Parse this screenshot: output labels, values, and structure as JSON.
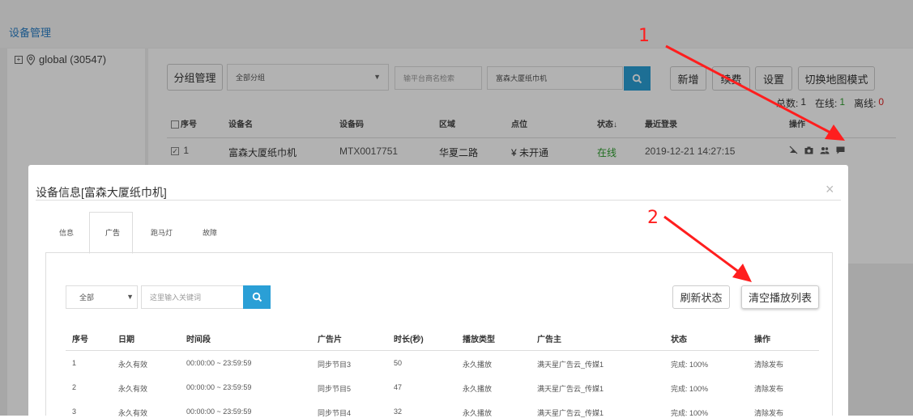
{
  "breadcrumb": "设备管理",
  "tree": {
    "node_label": "global (30547)"
  },
  "toolbar": {
    "group_manage": "分组管理",
    "group_select": "全部分组",
    "platform_search_placeholder": "输平台商名检索",
    "keyword_value": "富森大厦纸巾机",
    "add": "新增",
    "renew": "续费",
    "settings": "设置",
    "map_mode": "切换地图模式"
  },
  "stats": {
    "total_label": "总数:",
    "total": "1",
    "online_label": "在线:",
    "online": "1",
    "offline_label": "离线:",
    "offline": "0"
  },
  "device_table": {
    "headers": [
      "序号",
      "设备名",
      "设备码",
      "区域",
      "点位",
      "状态↓",
      "最近登录",
      "操作"
    ],
    "row": {
      "index": "1",
      "name": "富森大厦纸巾机",
      "code": "MTX0017751",
      "area": "华夏二路",
      "point": "¥ 未开通",
      "status": "在线",
      "last_login": "2019-12-21 14:27:15"
    }
  },
  "modal": {
    "title": "设备信息[富森大厦纸巾机]",
    "tabs": [
      "信息",
      "广告",
      "跑马灯",
      "故障"
    ],
    "active_tab": 1,
    "filter_select": "全部",
    "keyword_placeholder": "这里输入关键词",
    "refresh_button": "刷新状态",
    "clear_button": "清空播放列表",
    "ad_table": {
      "headers": [
        "序号",
        "日期",
        "时间段",
        "广告片",
        "时长(秒)",
        "播放类型",
        "广告主",
        "状态",
        "操作"
      ],
      "rows": [
        [
          "1",
          "永久有效",
          "00:00:00 ~ 23:59:59",
          "同步节目3",
          "50",
          "永久播放",
          "满天星广告云_传媒1",
          "完成: 100%",
          "清除发布"
        ],
        [
          "2",
          "永久有效",
          "00:00:00 ~ 23:59:59",
          "同步节目5",
          "47",
          "永久播放",
          "满天星广告云_传媒1",
          "完成: 100%",
          "清除发布"
        ],
        [
          "3",
          "永久有效",
          "00:00:00 ~ 23:59:59",
          "同步节目4",
          "32",
          "永久播放",
          "满天星广告云_传媒1",
          "完成: 100%",
          "清除发布"
        ]
      ]
    }
  },
  "annotations": [
    "1",
    "2"
  ],
  "colors": {
    "accent": "#2a9fd6",
    "online": "#2e9e2e",
    "offline": "#e02020",
    "arrow": "#ff1e1e"
  }
}
